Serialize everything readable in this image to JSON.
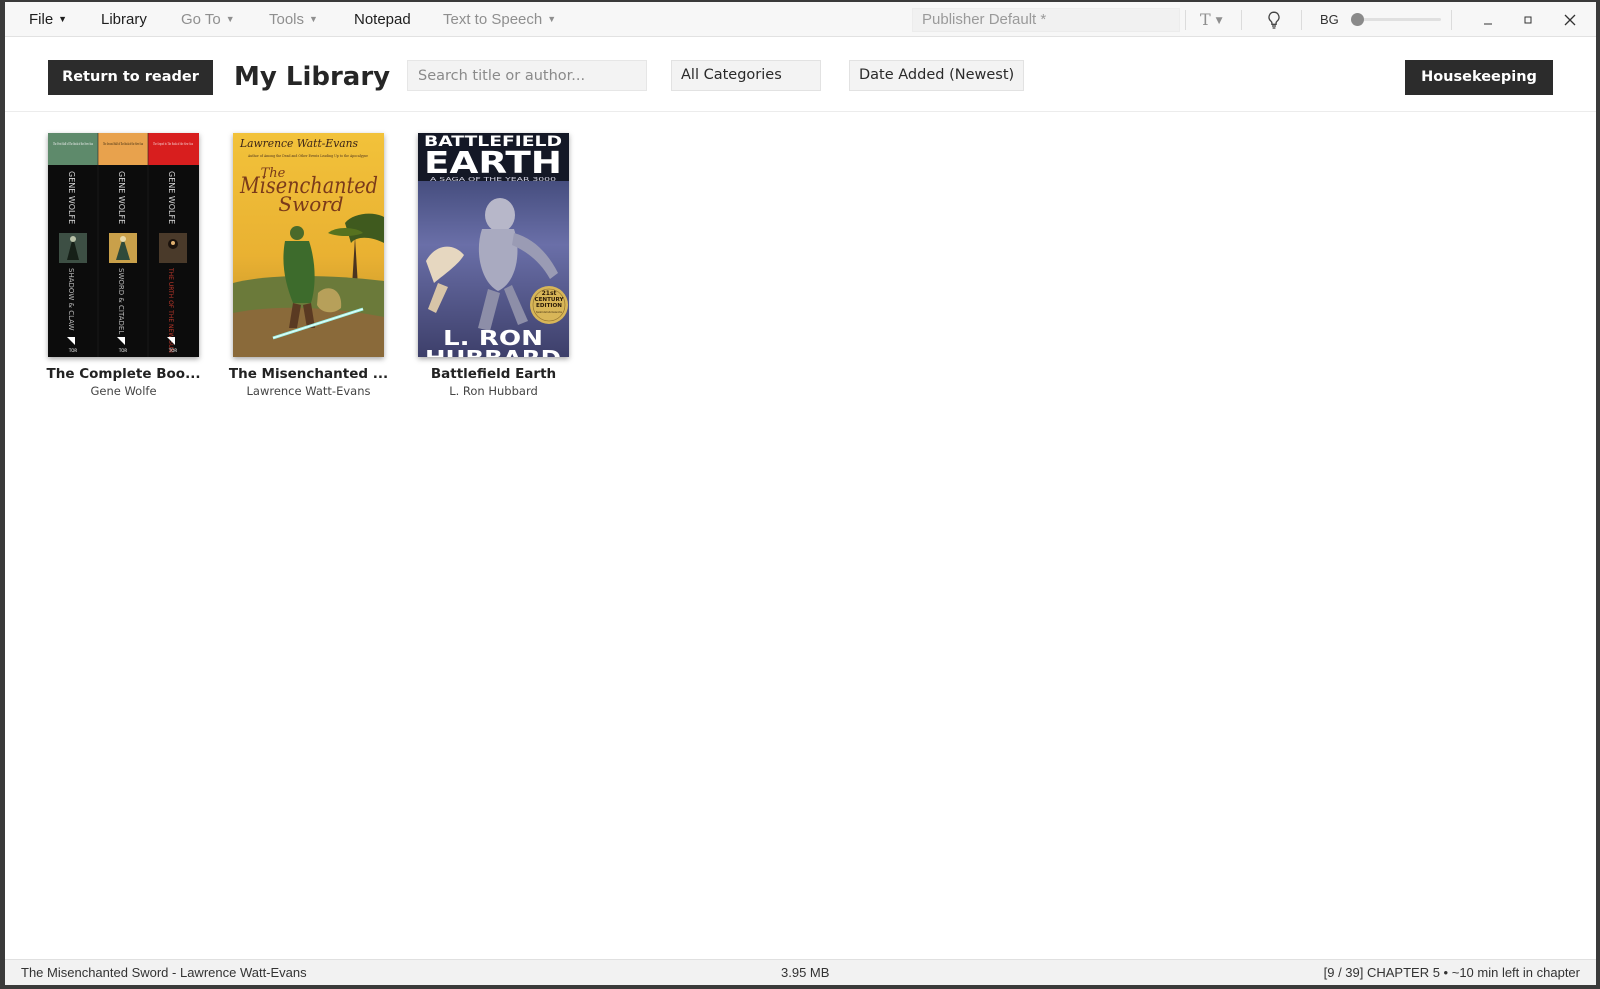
{
  "menubar": {
    "file": "File",
    "library": "Library",
    "goto": "Go To",
    "tools": "Tools",
    "notepad": "Notepad",
    "tts": "Text to Speech",
    "publisher_style": "Publisher Default *",
    "font_glyph": "T",
    "bg_label": "BG",
    "bg_level": 0
  },
  "toolbar": {
    "return_label": "Return to reader",
    "title": "My Library",
    "search_placeholder": "Search title or author...",
    "search_value": "",
    "category": "All Categories",
    "sort": "Date Added (Newest)",
    "housekeeping_label": "Housekeeping"
  },
  "books": [
    {
      "title": "The Complete Boo...",
      "author": "Gene Wolfe",
      "cover": {
        "spines": [
          {
            "band": "#5e8a6b",
            "author": "GENE WOLFE",
            "title": "SHADOW & CLAW",
            "title_color": "#bdbdbd",
            "blurb": "The First Half of The Book of the New Sun"
          },
          {
            "band": "#e8a24d",
            "author": "GENE WOLFE",
            "title": "SWORD & CITADEL",
            "title_color": "#bdbdbd",
            "blurb": "The Second Half of The Book of the New Sun"
          },
          {
            "band": "#d81e1e",
            "author": "GENE WOLFE",
            "title": "THE URTH OF THE NEW SUN",
            "title_color": "#c0392b",
            "blurb": "The Sequel to The Book of the New Sun"
          }
        ],
        "publisher_mark": "TOR"
      }
    },
    {
      "title": "The Misenchanted ...",
      "author": "Lawrence Watt-Evans",
      "cover": {
        "author_line": "Lawrence Watt-Evans",
        "title_line1": "The",
        "title_line2": "Misenchanted",
        "title_line3": "Sword",
        "blurb": "Author of Among the Dead and Other Events Leading Up to the Apocalypse"
      }
    },
    {
      "title": "Battlefield Earth",
      "author": "L. Ron Hubbard",
      "cover": {
        "title_line1": "BATTLEFIELD",
        "title_line2": "EARTH",
        "subtitle": "A SAGA OF THE YEAR 3000",
        "badge_line1": "21st",
        "badge_line2": "CENTURY",
        "badge_line3": "EDITION",
        "badge_note": "Expanded Content Author Interview Archive",
        "author_line1": "L. RON",
        "author_line2": "HUBBARD"
      }
    }
  ],
  "status": {
    "current_book": "The Misenchanted Sword - Lawrence Watt-Evans",
    "file_size": "3.95 MB",
    "progress": "[9 / 39] CHAPTER 5 • ~10 min left in chapter"
  },
  "colors": {
    "dark_button": "#2c2c2c",
    "menubar_bg": "#f7f7f7",
    "status_bg": "#f2f2f2"
  }
}
